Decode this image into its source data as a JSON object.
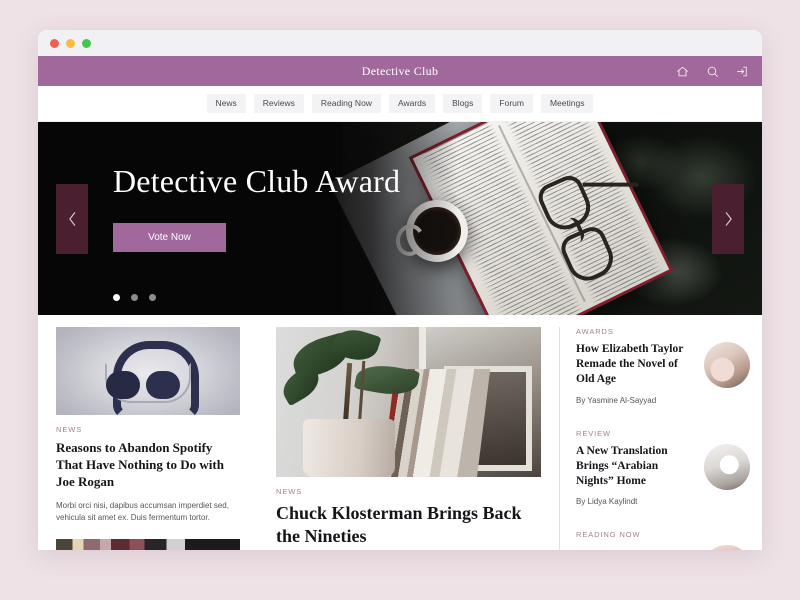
{
  "window": {
    "traffic_lights": [
      "close",
      "minimize",
      "maximize"
    ]
  },
  "header": {
    "brand": "Detective Club",
    "icons": [
      {
        "name": "home-icon",
        "label": "Home"
      },
      {
        "name": "search-icon",
        "label": "Search"
      },
      {
        "name": "login-icon",
        "label": "Sign in"
      }
    ]
  },
  "nav": {
    "items": [
      {
        "label": "News"
      },
      {
        "label": "Reviews"
      },
      {
        "label": "Reading Now"
      },
      {
        "label": "Awards"
      },
      {
        "label": "Blogs"
      },
      {
        "label": "Forum"
      },
      {
        "label": "Meetings"
      }
    ]
  },
  "hero": {
    "title": "Detective Club Award",
    "cta_label": "Vote Now",
    "prev_label": "Previous slide",
    "next_label": "Next slide",
    "dots": [
      {
        "active": true
      },
      {
        "active": false
      },
      {
        "active": false
      }
    ],
    "image_alt": "Open book with eyeglasses and a cup of black coffee on a grey table"
  },
  "main": {
    "left_card": {
      "kicker": "NEWS",
      "title": "Reasons to Abandon Spotify That Have Nothing to Do with Joe Rogan",
      "excerpt": "Morbi orci nisi, dapibus accumsan imperdiet sed, vehicula sit amet ex. Duis fermentum tortor.",
      "image_alt": "Navy over-ear headphones on a grey gradient background"
    },
    "center_card": {
      "kicker": "NEWS",
      "title": "Chuck Klosterman Brings Back the Nineties",
      "image_alt": "Potted plant and a row of books on a window sill"
    },
    "sidebar": {
      "items": [
        {
          "kicker": "AWARDS",
          "title": "How Elizabeth Taylor Remade the Novel of Old Age",
          "byline": "By Yasmine Al-Sayyad",
          "image_alt": "Person reading a magazine"
        },
        {
          "kicker": "REVIEW",
          "title": "A New Translation Brings “Arabian Nights” Home",
          "byline": "By Lidya Kaylindt",
          "image_alt": "Hands holding an open illustrated book"
        },
        {
          "kicker": "READING NOW",
          "title": "",
          "byline": "",
          "image_alt": "Partially visible thumbnail"
        }
      ]
    }
  },
  "colors": {
    "page_background": "#eee2e7",
    "brand_purple": "#a1699b",
    "hero_background": "#070607",
    "arrow_maroon": "#4a1f30",
    "kicker_mauve": "#a3828e",
    "nav_pill": "#f3f3f5",
    "text_dark": "#16151a"
  }
}
